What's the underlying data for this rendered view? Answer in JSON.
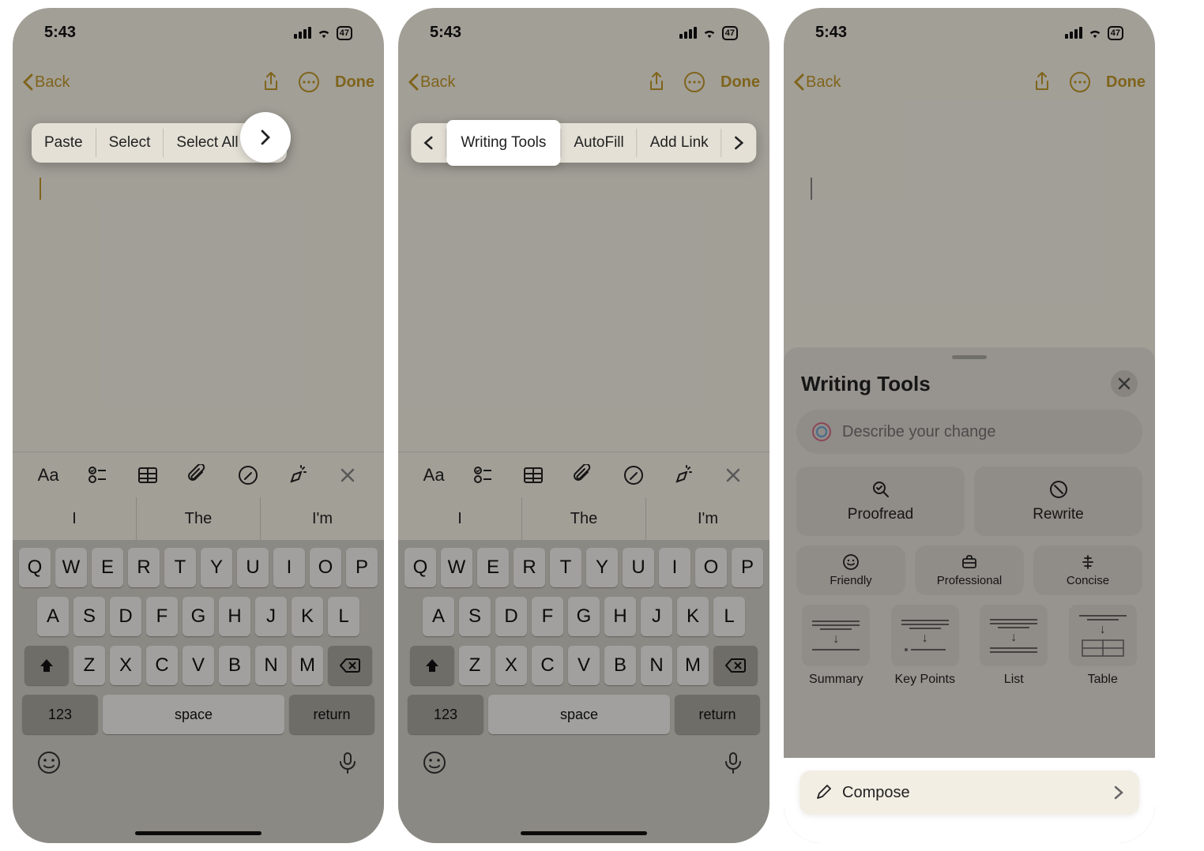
{
  "status": {
    "time": "5:43",
    "battery": "47"
  },
  "nav": {
    "back": "Back",
    "done": "Done"
  },
  "context_menu_1": {
    "paste": "Paste",
    "select": "Select",
    "select_all": "Select All"
  },
  "context_menu_2": {
    "writing_tools": "Writing Tools",
    "autofill": "AutoFill",
    "add_link": "Add Link"
  },
  "predictions": {
    "p1": "I",
    "p2": "The",
    "p3": "I'm"
  },
  "keyboard": {
    "row1": [
      "Q",
      "W",
      "E",
      "R",
      "T",
      "Y",
      "U",
      "I",
      "O",
      "P"
    ],
    "row2": [
      "A",
      "S",
      "D",
      "F",
      "G",
      "H",
      "J",
      "K",
      "L"
    ],
    "row3": [
      "Z",
      "X",
      "C",
      "V",
      "B",
      "N",
      "M"
    ],
    "num": "123",
    "space": "space",
    "return": "return"
  },
  "writing_tools": {
    "title": "Writing Tools",
    "placeholder": "Describe your change",
    "proofread": "Proofread",
    "rewrite": "Rewrite",
    "friendly": "Friendly",
    "professional": "Professional",
    "concise": "Concise",
    "summary": "Summary",
    "key_points": "Key Points",
    "list": "List",
    "table": "Table",
    "compose": "Compose"
  }
}
